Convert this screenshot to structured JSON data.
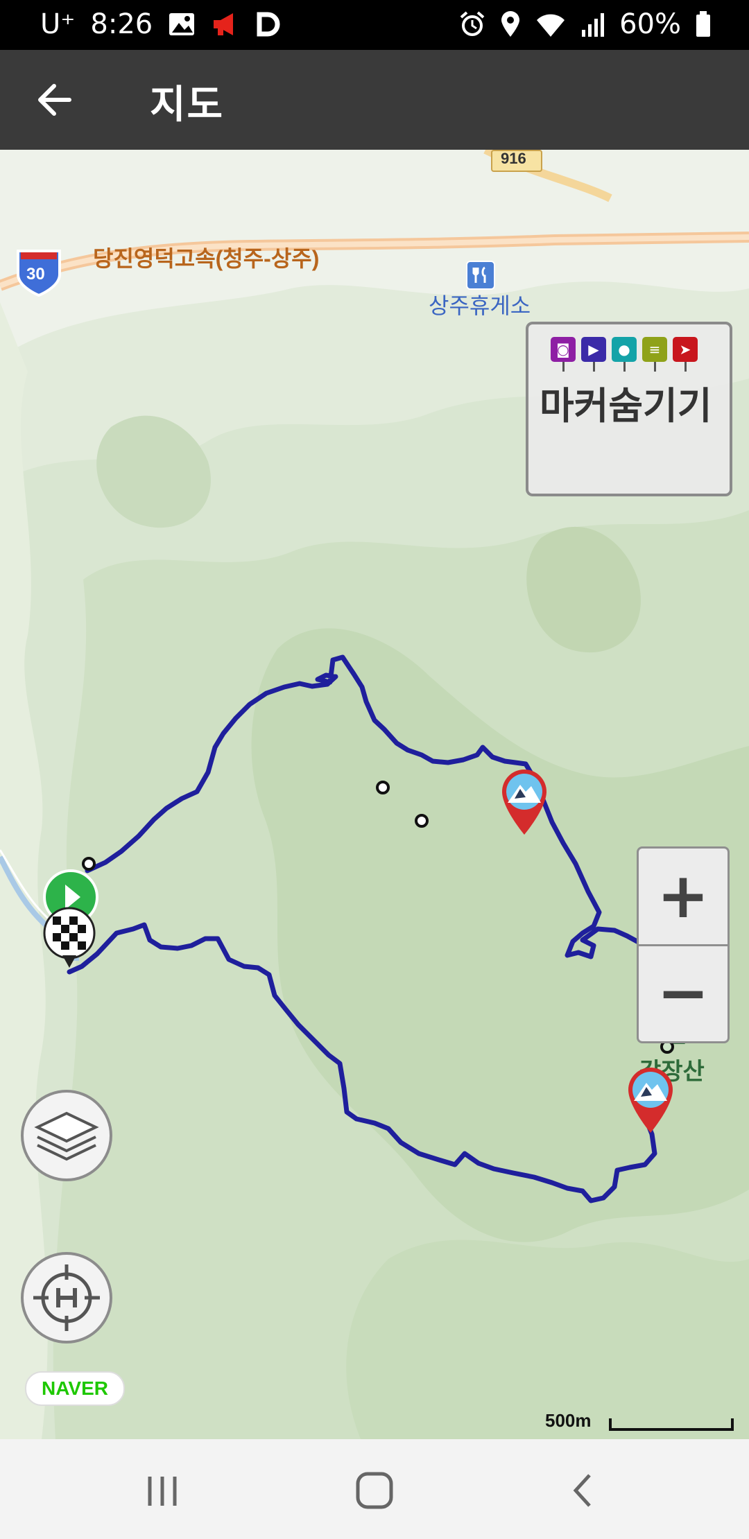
{
  "status_bar": {
    "carrier": "U⁺",
    "time": "8:26",
    "battery": "60%",
    "icons_left": [
      "image-icon",
      "megaphone-icon",
      "d-app-icon"
    ],
    "icons_right": [
      "alarm-icon",
      "location-icon",
      "wifi-icon",
      "signal-icon",
      "battery-icon"
    ]
  },
  "app_bar": {
    "title": "지도"
  },
  "map": {
    "road_number_916": "916",
    "highway_shield": "30",
    "highway_name": "당진영덕고속(청주-상주)",
    "rest_area": "상주휴게소",
    "peak_label": "갑장산"
  },
  "marker_box": {
    "label": "마커숨기기",
    "pin_colors": [
      "#8e1fa4",
      "#3b2aa8",
      "#14a3a8",
      "#8fa219",
      "#c8161d"
    ]
  },
  "zoom": {
    "plus": "+",
    "minus": "−"
  },
  "controls": {
    "layers_icon": "layers-icon",
    "location_icon": "home-crosshair-icon"
  },
  "attribution": {
    "naver": "NAVER",
    "scale": "500m"
  },
  "colors": {
    "route": "#1f1f9c",
    "marker_red": "#d42c2c",
    "start_green": "#2db34a"
  }
}
